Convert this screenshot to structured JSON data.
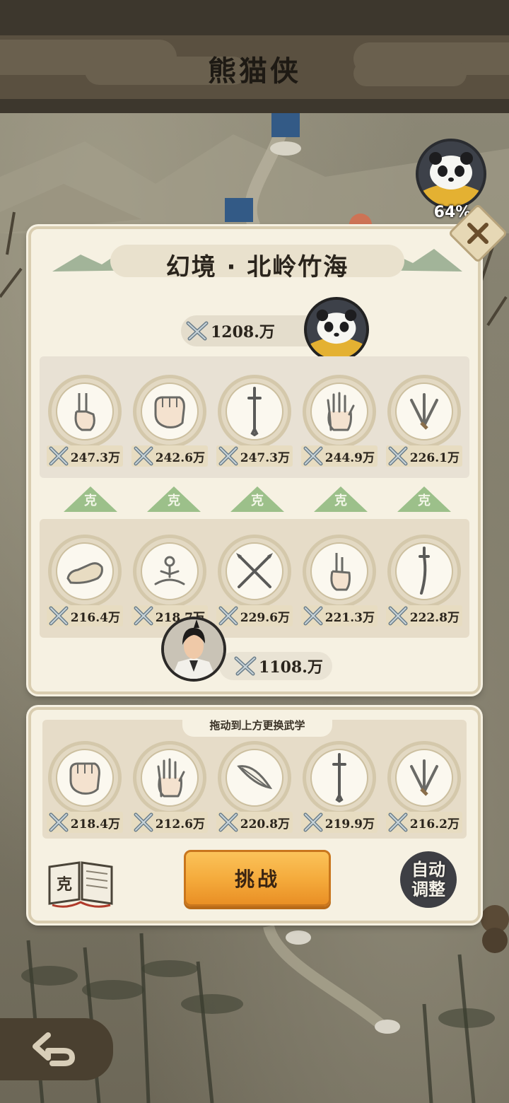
{
  "header": {
    "title": "熊猫侠"
  },
  "player": {
    "progress_pct": "64%"
  },
  "panel": {
    "title": "幻境 · 北岭竹海",
    "enemy_power": "1208.万",
    "enemy_skills": [
      {
        "icon": "two-finger-hand-icon",
        "power": "247.3万"
      },
      {
        "icon": "fist-icon",
        "power": "242.6万"
      },
      {
        "icon": "sword-icon",
        "power": "247.3万"
      },
      {
        "icon": "palm-icon",
        "power": "244.9万"
      },
      {
        "icon": "throwing-knives-icon",
        "power": "226.1万"
      }
    ],
    "counter_label": "克",
    "player_skills": [
      {
        "icon": "shoe-icon",
        "power": "216.4万"
      },
      {
        "icon": "meditation-icon",
        "power": "218.7万"
      },
      {
        "icon": "crossed-spears-icon",
        "power": "229.6万"
      },
      {
        "icon": "finger-hand-icon",
        "power": "221.3万"
      },
      {
        "icon": "saber-icon",
        "power": "222.8万"
      }
    ],
    "hero_power": "1108.万"
  },
  "inventory": {
    "hint": "拖动到上方更换武学",
    "skills": [
      {
        "icon": "fist-icon",
        "power": "218.4万"
      },
      {
        "icon": "palm-icon",
        "power": "212.6万"
      },
      {
        "icon": "feather-icon",
        "power": "220.8万"
      },
      {
        "icon": "sword-icon",
        "power": "219.9万"
      },
      {
        "icon": "throwing-knives-icon",
        "power": "216.2万"
      }
    ],
    "challenge_label": "挑战",
    "book_label": "克",
    "auto_adjust_label_1": "自动",
    "auto_adjust_label_2": "调整"
  },
  "colors": {
    "panel_bg": "#f6f1e2",
    "counter_badge": "#9cc08a",
    "challenge_button": "#f4a93a"
  }
}
